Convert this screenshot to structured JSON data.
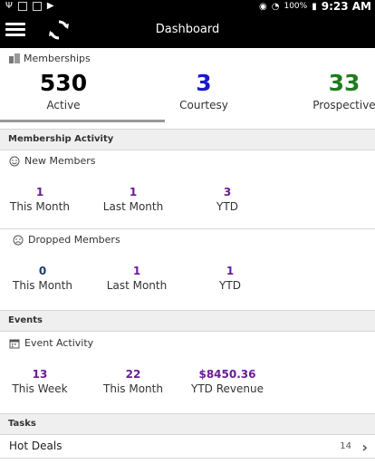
{
  "status_bar": {
    "time": "9:23 AM",
    "battery": "100%"
  },
  "app_bar": {
    "title": "Dashboard"
  },
  "memberships": {
    "heading": "Memberships",
    "stats": [
      {
        "value": "530",
        "label": "Active",
        "color": "#000000"
      },
      {
        "value": "3",
        "label": "Courtesy",
        "color": "#1a1acc"
      },
      {
        "value": "33",
        "label": "Prospective",
        "color": "#1e7d1e"
      }
    ]
  },
  "membership_activity": {
    "heading": "Membership Activity",
    "new_members": {
      "heading": "New Members",
      "items": [
        {
          "value": "1",
          "label": "This Month"
        },
        {
          "value": "1",
          "label": "Last Month"
        },
        {
          "value": "3",
          "label": "YTD"
        }
      ]
    },
    "dropped_members": {
      "heading": "Dropped Members",
      "items": [
        {
          "value": "0",
          "label": "This Month"
        },
        {
          "value": "1",
          "label": "Last Month"
        },
        {
          "value": "1",
          "label": "YTD"
        }
      ]
    }
  },
  "events": {
    "heading": "Events",
    "activity": {
      "heading": "Event Activity",
      "items": [
        {
          "value": "13",
          "label": "This Week"
        },
        {
          "value": "22",
          "label": "This Month"
        },
        {
          "value": "$8450.36",
          "label": "YTD Revenue"
        }
      ]
    }
  },
  "tasks": {
    "heading": "Tasks",
    "rows": [
      {
        "label": "Hot Deals",
        "count": "14"
      }
    ]
  }
}
